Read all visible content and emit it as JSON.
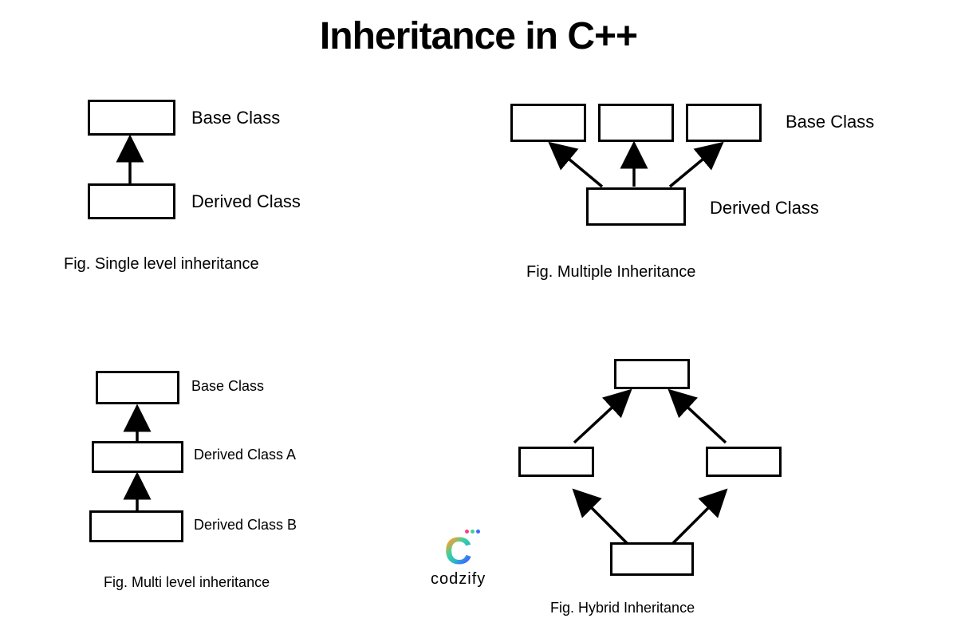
{
  "title": "Inheritance in C++",
  "diagrams": {
    "single": {
      "box_labels": {
        "base": "Base Class",
        "derived": "Derived Class"
      },
      "caption": "Fig. Single level inheritance"
    },
    "multiple": {
      "box_labels": {
        "base": "Base Class",
        "derived": "Derived Class"
      },
      "caption": "Fig. Multiple Inheritance"
    },
    "multi": {
      "box_labels": {
        "base": "Base Class",
        "derivedA": "Derived Class A",
        "derivedB": "Derived Class B"
      },
      "caption": "Fig. Multi level inheritance"
    },
    "hybrid": {
      "caption": "Fig. Hybrid Inheritance"
    }
  },
  "brand": "codzify"
}
